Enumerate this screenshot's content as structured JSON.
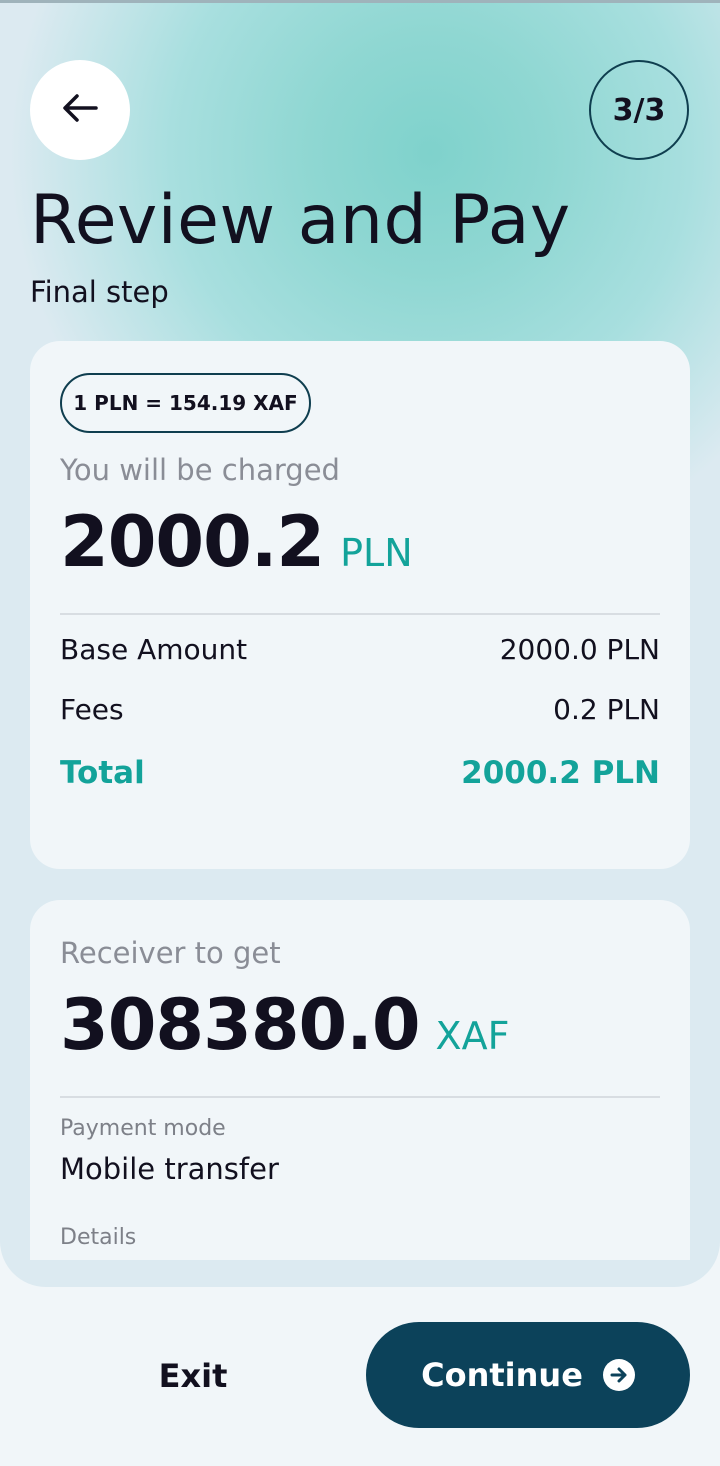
{
  "header": {
    "step": "3/3",
    "title": "Review and Pay",
    "subtitle": "Final step",
    "icons": {
      "back": "arrow-left-icon",
      "continue": "arrow-right-circle-icon"
    }
  },
  "charge_card": {
    "rate": "1 PLN = 154.19 XAF",
    "charged_label": "You will be charged",
    "charged_amount": "2000.2",
    "charged_currency": "PLN",
    "rows": [
      {
        "label": "Base Amount",
        "value": "2000.0 PLN"
      },
      {
        "label": "Fees",
        "value": "0.2 PLN"
      },
      {
        "label": "Total",
        "value": "2000.2 PLN"
      }
    ]
  },
  "receiver_card": {
    "receiver_label": "Receiver to get",
    "receiver_amount": "308380.0",
    "receiver_currency": "XAF",
    "payment_mode_label": "Payment mode",
    "payment_mode_value": "Mobile transfer",
    "details_label": "Details"
  },
  "footer": {
    "exit_label": "Exit",
    "continue_label": "Continue"
  },
  "colors": {
    "accent": "#13a39a",
    "primary": "#0c425a",
    "text": "#12101f",
    "muted": "#8a8d96"
  }
}
